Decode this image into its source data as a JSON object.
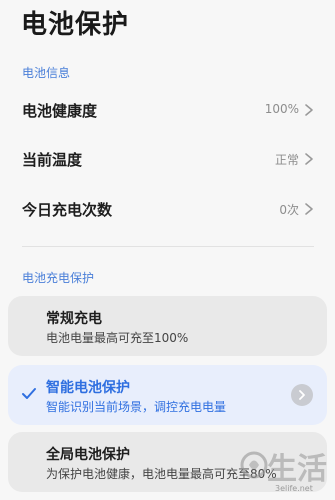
{
  "page": {
    "title": "电池保护"
  },
  "battery_info": {
    "header": "电池信息",
    "rows": [
      {
        "label": "电池健康度",
        "value": "100%"
      },
      {
        "label": "当前温度",
        "value": "正常"
      },
      {
        "label": "今日充电次数",
        "value": "0次"
      }
    ]
  },
  "charge_protection": {
    "header": "电池充电保护",
    "options": [
      {
        "title": "常规充电",
        "subtitle": "电池电量最高可充至100%",
        "selected": false
      },
      {
        "title": "智能电池保护",
        "subtitle": "智能识别当前场景，调控充电电量",
        "selected": true
      },
      {
        "title": "全局电池保护",
        "subtitle": "为保护电池健康，电池电量最高可充至80%",
        "selected": false
      }
    ]
  },
  "colors": {
    "accent": "#2f6fe0",
    "section_header": "#4a7fd8",
    "selected_card_bg": "#e8eefc",
    "card_bg": "#e9e9e9",
    "page_bg": "#f7f7f7"
  },
  "watermark": {
    "text": "生活",
    "url": "3elife.net"
  }
}
